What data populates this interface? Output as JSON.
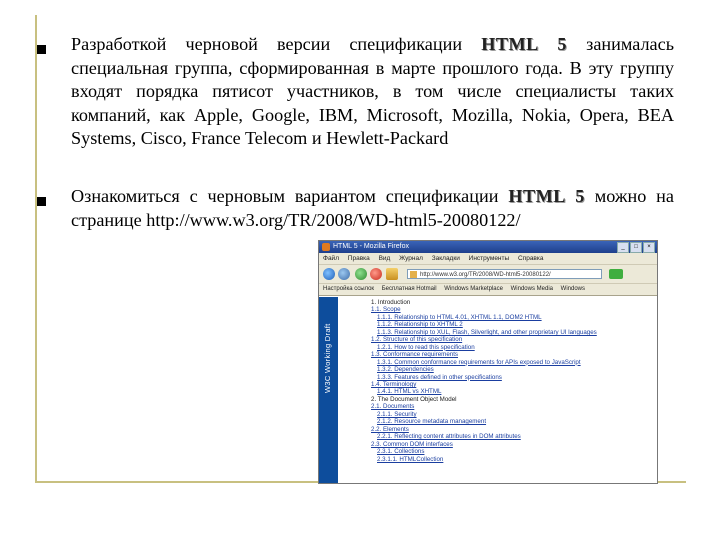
{
  "slide": {
    "bullets": [
      {
        "before": "Разработкой черновой версии спецификации ",
        "highlight": "HTML 5",
        "after": " занималась специальная группа, сформированная в марте прошлого года. В эту группу входят порядка пятисот участников, в том числе специалисты таких компаний, как Apple, Google, IBM, Microsoft, Mozilla, Nokia, Opera, BEA Systems, Cisco, France Telecom и Hewlett-Packard"
      },
      {
        "before": "Ознакомиться с черновым вариантом спецификации ",
        "highlight": "HTML 5",
        "after": " можно на странице ",
        "url": "http://www.w3.org/TR/2008/WD-html5-20080122/"
      }
    ]
  },
  "browser": {
    "title": "HTML 5 - Mozilla Firefox",
    "window_buttons": [
      "_",
      "□",
      "×"
    ],
    "menu": [
      "Файл",
      "Правка",
      "Вид",
      "Журнал",
      "Закладки",
      "Инструменты",
      "Справка"
    ],
    "address": "http://www.w3.org/TR/2008/WD-html5-20080122/",
    "bookmarks": [
      "Настройка ссылок",
      "Бесплатная Hotmail",
      "Windows Marketplace",
      "Windows Media",
      "Windows"
    ],
    "sidebar_label": "W3C Working Draft",
    "toc": [
      {
        "level": 0,
        "text": "1. Introduction"
      },
      {
        "level": 1,
        "text": "1.1. Scope"
      },
      {
        "level": 2,
        "text": "1.1.1. Relationship to HTML 4.01, XHTML 1.1, DOM2 HTML"
      },
      {
        "level": 2,
        "text": "1.1.2. Relationship to XHTML 2"
      },
      {
        "level": 2,
        "text": "1.1.3. Relationship to XUL, Flash, Silverlight, and other proprietary UI languages"
      },
      {
        "level": 1,
        "text": "1.2. Structure of this specification"
      },
      {
        "level": 2,
        "text": "1.2.1. How to read this specification"
      },
      {
        "level": 1,
        "text": "1.3. Conformance requirements"
      },
      {
        "level": 2,
        "text": "1.3.1. Common conformance requirements for APIs exposed to JavaScript"
      },
      {
        "level": 2,
        "text": "1.3.2. Dependencies"
      },
      {
        "level": 2,
        "text": "1.3.3. Features defined in other specifications"
      },
      {
        "level": 1,
        "text": "1.4. Terminology"
      },
      {
        "level": 2,
        "text": "1.4.1. HTML vs XHTML"
      },
      {
        "level": 0,
        "text": "2. The Document Object Model"
      },
      {
        "level": 1,
        "text": "2.1. Documents"
      },
      {
        "level": 2,
        "text": "2.1.1. Security"
      },
      {
        "level": 2,
        "text": "2.1.2. Resource metadata management"
      },
      {
        "level": 1,
        "text": "2.2. Elements"
      },
      {
        "level": 2,
        "text": "2.2.1. Reflecting content attributes in DOM attributes"
      },
      {
        "level": 1,
        "text": "2.3. Common DOM interfaces"
      },
      {
        "level": 2,
        "text": "2.3.1. Collections"
      },
      {
        "level": 2,
        "text": "2.3.1.1. HTMLCollection"
      }
    ]
  },
  "colors": {
    "frame": "#c8c080",
    "sidebar": "#0d4d9c",
    "titlebar": "#2a54a8"
  }
}
